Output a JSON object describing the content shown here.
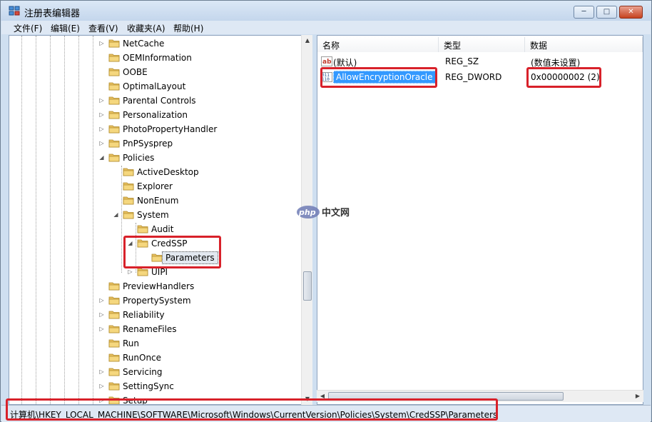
{
  "window": {
    "title": "注册表编辑器",
    "buttons": {
      "minimize": "─",
      "maximize": "□",
      "close": "✕"
    }
  },
  "menu": [
    {
      "label": "文件(F)"
    },
    {
      "label": "编辑(E)"
    },
    {
      "label": "查看(V)"
    },
    {
      "label": "收藏夹(A)"
    },
    {
      "label": "帮助(H)"
    }
  ],
  "tree": {
    "items": [
      {
        "label": "NetCache",
        "expander": "▷"
      },
      {
        "label": "OEMInformation",
        "expander": ""
      },
      {
        "label": "OOBE",
        "expander": ""
      },
      {
        "label": "OptimalLayout",
        "expander": ""
      },
      {
        "label": "Parental Controls",
        "expander": "▷"
      },
      {
        "label": "Personalization",
        "expander": "▷"
      },
      {
        "label": "PhotoPropertyHandler",
        "expander": "▷"
      },
      {
        "label": "PnPSysprep",
        "expander": "▷"
      },
      {
        "label": "Policies",
        "expander": "◢"
      },
      {
        "label": "ActiveDesktop",
        "expander": ""
      },
      {
        "label": "Explorer",
        "expander": ""
      },
      {
        "label": "NonEnum",
        "expander": ""
      },
      {
        "label": "System",
        "expander": "◢"
      },
      {
        "label": "Audit",
        "expander": ""
      },
      {
        "label": "CredSSP",
        "expander": "◢"
      },
      {
        "label": "Parameters",
        "expander": ""
      },
      {
        "label": "UIPI",
        "expander": "▷"
      },
      {
        "label": "PreviewHandlers",
        "expander": ""
      },
      {
        "label": "PropertySystem",
        "expander": "▷"
      },
      {
        "label": "Reliability",
        "expander": "▷"
      },
      {
        "label": "RenameFiles",
        "expander": "▷"
      },
      {
        "label": "Run",
        "expander": ""
      },
      {
        "label": "RunOnce",
        "expander": ""
      },
      {
        "label": "Servicing",
        "expander": "▷"
      },
      {
        "label": "SettingSync",
        "expander": "▷"
      },
      {
        "label": "Setup",
        "expander": "▷"
      }
    ],
    "selected": "Parameters"
  },
  "list": {
    "columns": [
      "名称",
      "类型",
      "数据"
    ],
    "rows": [
      {
        "icon": "string-value-icon",
        "name": "(默认)",
        "type": "REG_SZ",
        "data": "(数值未设置)"
      },
      {
        "icon": "dword-value-icon",
        "name": "AllowEncryptionOracle",
        "type": "REG_DWORD",
        "data": "0x00000002 (2)"
      }
    ]
  },
  "status": {
    "path": "计算机\\HKEY_LOCAL_MACHINE\\SOFTWARE\\Microsoft\\Windows\\CurrentVersion\\Policies\\System\\CredSSP\\Parameters"
  },
  "watermark": {
    "text_php": "php",
    "text_cn": "中文网"
  },
  "colors": {
    "highlight_box": "#d8212a",
    "selection": "#3399ff",
    "folder": "#e8c060"
  }
}
